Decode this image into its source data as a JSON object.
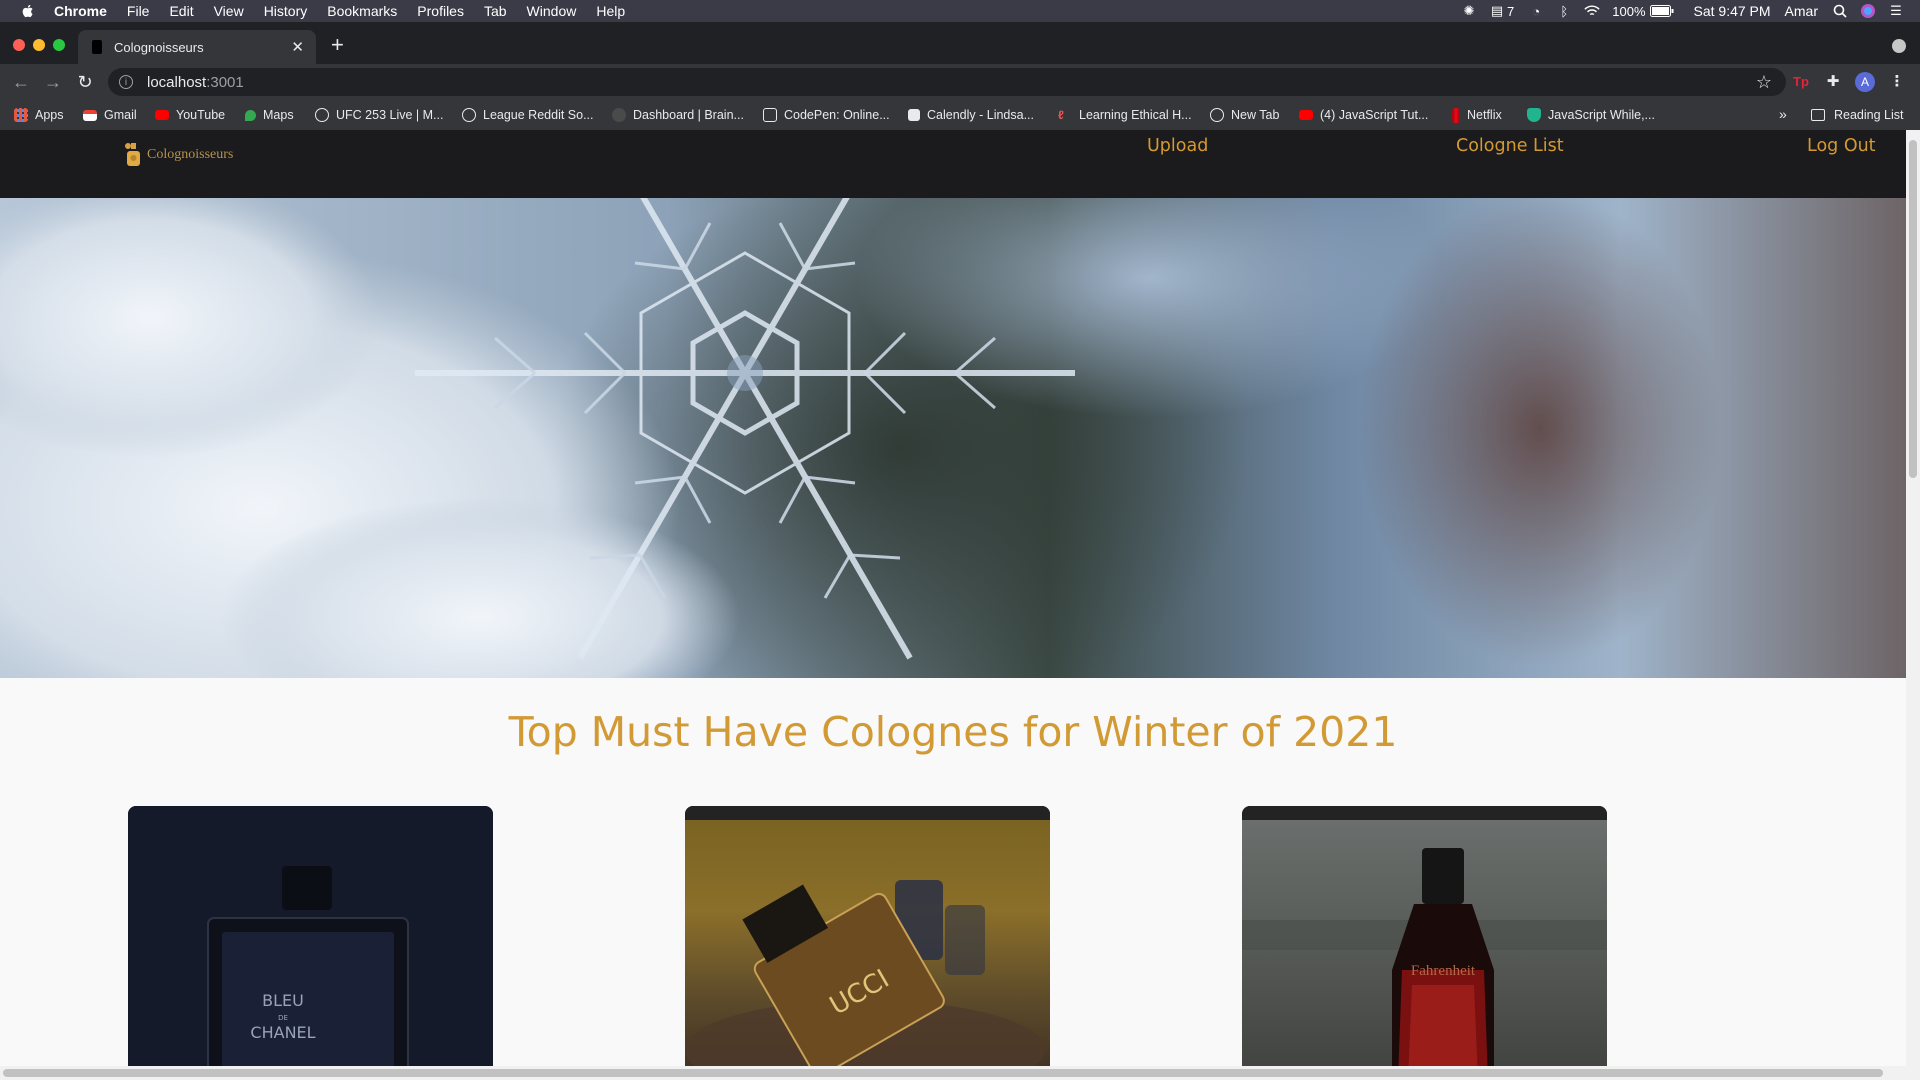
{
  "menubar": {
    "app_name": "Chrome",
    "menus": [
      "File",
      "Edit",
      "View",
      "History",
      "Bookmarks",
      "Profiles",
      "Tab",
      "Window",
      "Help"
    ],
    "notification_count": "7",
    "battery": "100%",
    "datetime": "Sat 9:47 PM",
    "user": "Amar"
  },
  "browser": {
    "tab_title": "Colognoisseurs",
    "url_host": "localhost",
    "url_port": ":3001",
    "avatar_letter": "A",
    "bookmarks": [
      {
        "label": "Apps",
        "icon": "apps-grid-icon",
        "color": "#e9573f"
      },
      {
        "label": "Gmail",
        "icon": "gmail-icon",
        "color": "#ea4335"
      },
      {
        "label": "YouTube",
        "icon": "youtube-icon",
        "color": "#ff0000"
      },
      {
        "label": "Maps",
        "icon": "maps-pin-icon",
        "color": "#34a853"
      },
      {
        "label": "UFC 253 Live | M...",
        "icon": "globe-icon",
        "color": "#e8eaed"
      },
      {
        "label": "League Reddit So...",
        "icon": "globe-icon",
        "color": "#e8eaed"
      },
      {
        "label": "Dashboard | Brain...",
        "icon": "brain-icon",
        "color": "#3c3c3c"
      },
      {
        "label": "CodePen: Online...",
        "icon": "codepen-icon",
        "color": "#e8eaed"
      },
      {
        "label": "Calendly - Lindsa...",
        "icon": "calendly-icon",
        "color": "#e8eaed"
      },
      {
        "label": "Learning Ethical H...",
        "icon": "udemy-icon",
        "color": "#ec5252"
      },
      {
        "label": "New Tab",
        "icon": "globe-icon",
        "color": "#e8eaed"
      },
      {
        "label": "(4) JavaScript Tut...",
        "icon": "youtube-icon",
        "color": "#ff0000"
      },
      {
        "label": "Netflix",
        "icon": "netflix-icon",
        "color": "#e50914"
      },
      {
        "label": "JavaScript While,...",
        "icon": "shield-icon",
        "color": "#1fb58f"
      }
    ],
    "more_bookmarks": "»",
    "reading_list": "Reading List"
  },
  "site": {
    "logo_text": "Colognoisseurs",
    "nav": {
      "upload": "Upload",
      "cologne_list": "Cologne List",
      "log_out": "Log Out"
    },
    "heading": "Top Must Have Colognes for Winter of 2021",
    "accent_color": "#d29a35",
    "cards": [
      {
        "name": "card-bleu-de-chanel",
        "bottle_text_1": "BLEU",
        "bottle_text_2": "DE",
        "bottle_text_3": "CHANEL"
      },
      {
        "name": "card-gucci",
        "bottle_text_1": "UCCI"
      },
      {
        "name": "card-fahrenheit",
        "bottle_text_1": "Fahrenheit"
      }
    ]
  }
}
